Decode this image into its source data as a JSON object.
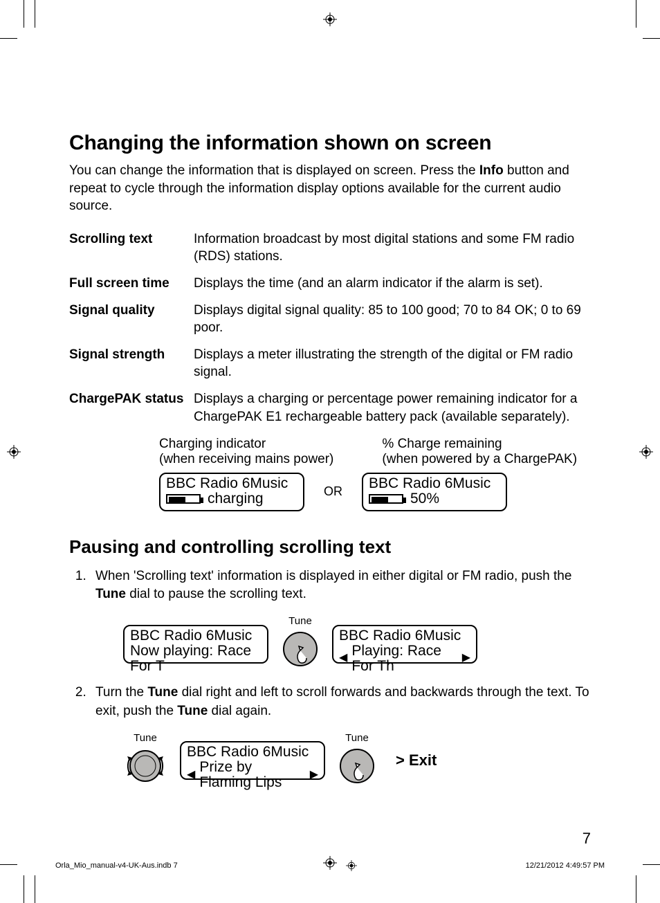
{
  "heading1": "Changing the information shown on screen",
  "intro_pre": "You can change the information that is displayed on screen. Press the ",
  "intro_bold": "Info",
  "intro_post": " button and repeat to cycle through the information display options available for the current audio source.",
  "defs": [
    {
      "label": "Scrolling text",
      "desc": "Information broadcast by most digital stations and some FM radio (RDS) stations."
    },
    {
      "label": "Full screen time",
      "desc": "Displays the time (and an alarm indicator if the alarm is set)."
    },
    {
      "label": "Signal quality",
      "desc": "Displays digital signal quality: 85 to 100 good; 70 to 84 OK; 0 to 69 poor."
    },
    {
      "label": "Signal strength",
      "desc": "Displays a meter illustrating the strength of the digital or FM radio signal."
    },
    {
      "label": "ChargePAK status",
      "desc": "Displays a charging or percentage power remaining indicator for a ChargePAK E1 rechargeable battery pack (available separately)."
    }
  ],
  "indicator_left_1": "Charging indicator",
  "indicator_left_2": "(when receiving mains power)",
  "indicator_right_1": "% Charge remaining",
  "indicator_right_2": "(when powered by a ChargePAK)",
  "lcd_charging_1": "BBC Radio 6Music",
  "lcd_charging_2": "charging",
  "or_label": "OR",
  "lcd_pct_1": "BBC Radio 6Music",
  "lcd_pct_2": "50%",
  "heading2": "Pausing and controlling scrolling text",
  "step1_pre": "When 'Scrolling text' information is displayed in either digital or FM radio, push the ",
  "step1_bold": "Tune",
  "step1_post": " dial to pause the scrolling text.",
  "tune_label": "Tune",
  "lcd_now_1": "BBC Radio 6Music",
  "lcd_now_2": "Now playing: Race For T",
  "lcd_play_1": "BBC Radio 6Music",
  "lcd_play_2": "Playing: Race For Th",
  "step2_a": "Turn the ",
  "step2_b": "Tune",
  "step2_c": " dial right and left to scroll forwards and backwards through the text. To exit, push the ",
  "step2_d": "Tune",
  "step2_e": " dial again.",
  "lcd_prize_1": "BBC Radio 6Music",
  "lcd_prize_2": "Prize by Flaming Lips",
  "exit_label": "> Exit",
  "page_number": "7",
  "footer_left": "Orla_Mio_manual-v4-UK-Aus.indb   7",
  "footer_right": "12/21/2012   4:49:57 PM"
}
